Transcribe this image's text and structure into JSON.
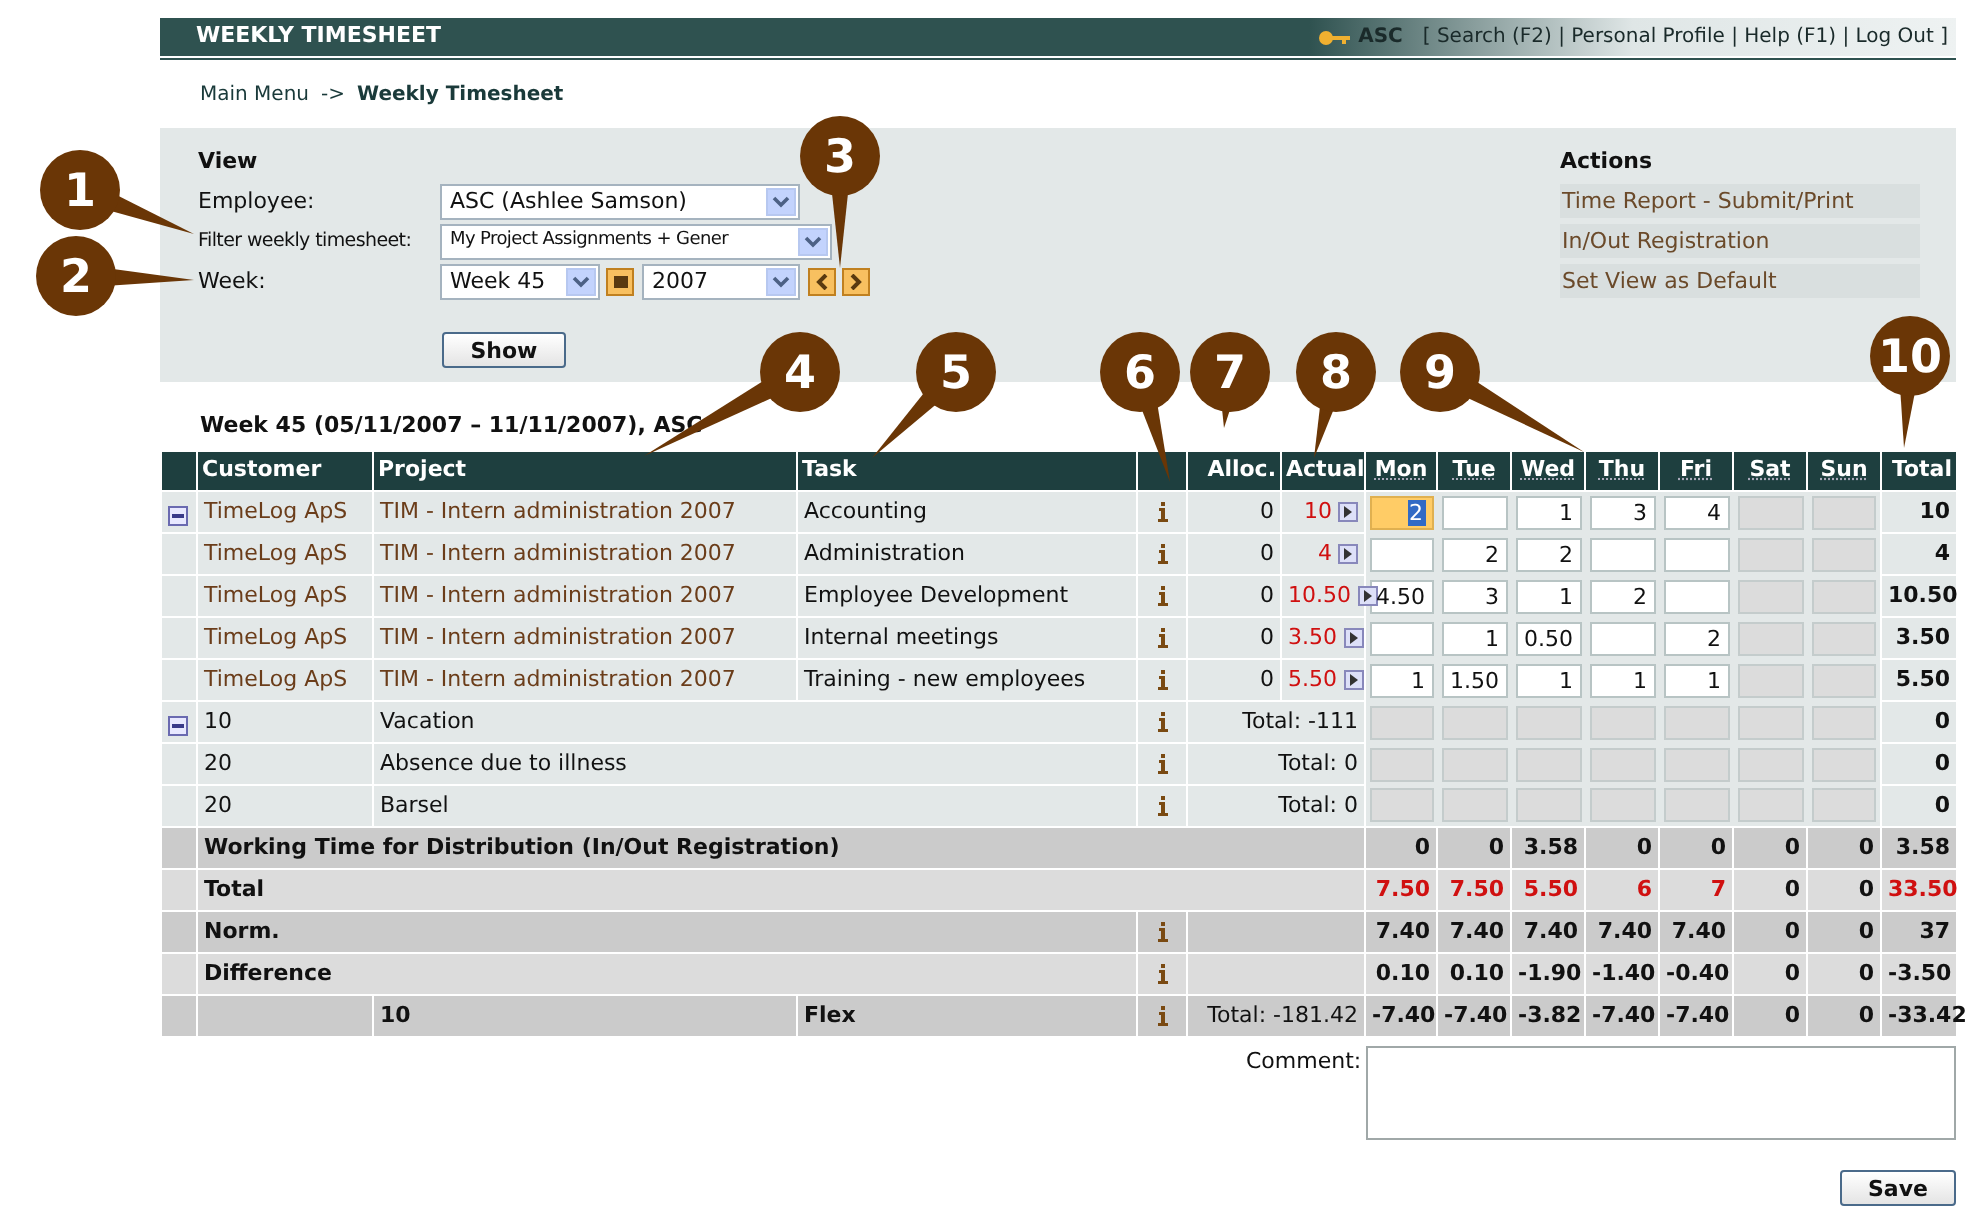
{
  "header": {
    "title": "WEEKLY TIMESHEET",
    "user": "ASC",
    "links_text": "[ Search (F2) | Personal Profile | Help (F1) | Log Out ]"
  },
  "breadcrumb": {
    "parent": "Main Menu",
    "arrow": "->",
    "current": "Weekly Timesheet"
  },
  "view": {
    "title": "View",
    "employee_label": "Employee:",
    "employee": "ASC (Ashlee Samson)",
    "filter_label": "Filter weekly timesheet:",
    "filter": "My Project Assignments + Gener",
    "week_label": "Week:",
    "week": "Week 45",
    "year": "2007",
    "show_button": "Show"
  },
  "actions": {
    "title": "Actions",
    "items": [
      "Time Report - Submit/Print",
      "In/Out Registration",
      "Set View as Default"
    ]
  },
  "week_title": "Week 45 (05/11/2007 – 11/11/2007), ASC",
  "table": {
    "columns": {
      "customer": "Customer",
      "project": "Project",
      "task": "Task",
      "alloc": "Alloc.",
      "actual": "Actual",
      "days": [
        "Mon",
        "Tue",
        "Wed",
        "Thu",
        "Fri",
        "Sat",
        "Sun"
      ],
      "total": "Total"
    },
    "rows": [
      {
        "kind": "task",
        "has_toggle": true,
        "customer": "TimeLog ApS",
        "project": "TIM - Intern administration 2007",
        "task": "Accounting",
        "alloc": "0",
        "actual": "10",
        "total": "10",
        "days": [
          {
            "value": "2",
            "selected": true,
            "disabled": false
          },
          {
            "selected": false,
            "disabled": false
          },
          {
            "value": "1",
            "selected": false,
            "disabled": false
          },
          {
            "value": "3",
            "selected": false,
            "disabled": false
          },
          {
            "value": "4",
            "selected": false,
            "disabled": false
          },
          {
            "selected": false,
            "disabled": true
          },
          {
            "selected": false,
            "disabled": true
          }
        ]
      },
      {
        "kind": "task",
        "has_toggle": false,
        "customer": "TimeLog ApS",
        "project": "TIM - Intern administration 2007",
        "task": "Administration",
        "alloc": "0",
        "actual": "4",
        "total": "4",
        "days": [
          {
            "selected": false,
            "disabled": false
          },
          {
            "value": "2",
            "selected": false,
            "disabled": false
          },
          {
            "value": "2",
            "selected": false,
            "disabled": false
          },
          {
            "selected": false,
            "disabled": false
          },
          {
            "selected": false,
            "disabled": false
          },
          {
            "selected": false,
            "disabled": true
          },
          {
            "selected": false,
            "disabled": true
          }
        ]
      },
      {
        "kind": "task",
        "has_toggle": false,
        "customer": "TimeLog ApS",
        "project": "TIM - Intern administration 2007",
        "task": "Employee Development",
        "alloc": "0",
        "actual": "10.50",
        "total": "10.50",
        "days": [
          {
            "value": "4.50",
            "selected": false,
            "disabled": false
          },
          {
            "value": "3",
            "selected": false,
            "disabled": false
          },
          {
            "value": "1",
            "selected": false,
            "disabled": false
          },
          {
            "value": "2",
            "selected": false,
            "disabled": false
          },
          {
            "selected": false,
            "disabled": false
          },
          {
            "selected": false,
            "disabled": true
          },
          {
            "selected": false,
            "disabled": true
          }
        ]
      },
      {
        "kind": "task",
        "has_toggle": false,
        "customer": "TimeLog ApS",
        "project": "TIM - Intern administration 2007",
        "task": "Internal meetings",
        "alloc": "0",
        "actual": "3.50",
        "total": "3.50",
        "days": [
          {
            "selected": false,
            "disabled": false
          },
          {
            "value": "1",
            "selected": false,
            "disabled": false
          },
          {
            "value": "0.50",
            "selected": false,
            "disabled": false
          },
          {
            "selected": false,
            "disabled": false
          },
          {
            "value": "2",
            "selected": false,
            "disabled": false
          },
          {
            "selected": false,
            "disabled": true
          },
          {
            "selected": false,
            "disabled": true
          }
        ]
      },
      {
        "kind": "task",
        "has_toggle": false,
        "customer": "TimeLog ApS",
        "project": "TIM - Intern administration 2007",
        "task": "Training - new employees",
        "alloc": "0",
        "actual": "5.50",
        "total": "5.50",
        "days": [
          {
            "value": "1",
            "selected": false,
            "disabled": false
          },
          {
            "value": "1.50",
            "selected": false,
            "disabled": false
          },
          {
            "value": "1",
            "selected": false,
            "disabled": false
          },
          {
            "value": "1",
            "selected": false,
            "disabled": false
          },
          {
            "value": "1",
            "selected": false,
            "disabled": false
          },
          {
            "selected": false,
            "disabled": true
          },
          {
            "selected": false,
            "disabled": true
          }
        ]
      },
      {
        "kind": "absence",
        "has_toggle": true,
        "code": "10",
        "name": "Vacation",
        "note": "Total: -111",
        "total": "0",
        "days": [
          {
            "selected": false,
            "disabled": true
          },
          {
            "selected": false,
            "disabled": true
          },
          {
            "selected": false,
            "disabled": true
          },
          {
            "selected": false,
            "disabled": true
          },
          {
            "selected": false,
            "disabled": true
          },
          {
            "selected": false,
            "disabled": true
          },
          {
            "selected": false,
            "disabled": true
          }
        ]
      },
      {
        "kind": "absence",
        "has_toggle": false,
        "code": "20",
        "name": "Absence due to illness",
        "note": "Total: 0",
        "total": "0",
        "days": [
          {
            "selected": false,
            "disabled": true
          },
          {
            "selected": false,
            "disabled": true
          },
          {
            "selected": false,
            "disabled": true
          },
          {
            "selected": false,
            "disabled": true
          },
          {
            "selected": false,
            "disabled": true
          },
          {
            "selected": false,
            "disabled": true
          },
          {
            "selected": false,
            "disabled": true
          }
        ]
      },
      {
        "kind": "absence",
        "has_toggle": false,
        "code": "20",
        "name": "Barsel",
        "note": "Total: 0",
        "total": "0",
        "days": [
          {
            "selected": false,
            "disabled": true
          },
          {
            "selected": false,
            "disabled": true
          },
          {
            "selected": false,
            "disabled": true
          },
          {
            "selected": false,
            "disabled": true
          },
          {
            "selected": false,
            "disabled": true
          },
          {
            "selected": false,
            "disabled": true
          },
          {
            "selected": false,
            "disabled": true
          }
        ]
      }
    ],
    "summary": [
      {
        "kind": "plain",
        "label": "Working Time for Distribution (In/Out Registration)",
        "values": [
          {
            "text": "0",
            "warning": false
          },
          {
            "text": "0",
            "warning": false
          },
          {
            "text": "3.58",
            "warning": false
          },
          {
            "text": "0",
            "warning": false
          },
          {
            "text": "0",
            "warning": false
          },
          {
            "text": "0",
            "warning": false
          },
          {
            "text": "0",
            "warning": false
          },
          {
            "text": "3.58",
            "warning": false
          }
        ]
      },
      {
        "kind": "plain",
        "label": "Total",
        "values": [
          {
            "text": "7.50",
            "warning": true
          },
          {
            "text": "7.50",
            "warning": true
          },
          {
            "text": "5.50",
            "warning": true
          },
          {
            "text": "6",
            "warning": true
          },
          {
            "text": "7",
            "warning": true
          },
          {
            "text": "0",
            "warning": false
          },
          {
            "text": "0",
            "warning": false
          },
          {
            "text": "33.50",
            "warning": true
          }
        ]
      },
      {
        "kind": "info",
        "label": "Norm.",
        "values": [
          {
            "text": "7.40",
            "warning": false
          },
          {
            "text": "7.40",
            "warning": false
          },
          {
            "text": "7.40",
            "warning": false
          },
          {
            "text": "7.40",
            "warning": false
          },
          {
            "text": "7.40",
            "warning": false
          },
          {
            "text": "0",
            "warning": false
          },
          {
            "text": "0",
            "warning": false
          },
          {
            "text": "37",
            "warning": false
          }
        ]
      },
      {
        "kind": "info",
        "label": "Difference",
        "values": [
          {
            "text": "0.10",
            "warning": false
          },
          {
            "text": "0.10",
            "warning": false
          },
          {
            "text": "-1.90",
            "warning": false
          },
          {
            "text": "-1.40",
            "warning": false
          },
          {
            "text": "-0.40",
            "warning": false
          },
          {
            "text": "0",
            "warning": false
          },
          {
            "text": "0",
            "warning": false
          },
          {
            "text": "-3.50",
            "warning": false
          }
        ]
      },
      {
        "kind": "flex",
        "code": "10",
        "name": "Flex",
        "note": "Total: -181.42",
        "values": [
          {
            "text": "-7.40",
            "warning": false
          },
          {
            "text": "-7.40",
            "warning": false
          },
          {
            "text": "-3.82",
            "warning": false
          },
          {
            "text": "-7.40",
            "warning": false
          },
          {
            "text": "-7.40",
            "warning": false
          },
          {
            "text": "0",
            "warning": false
          },
          {
            "text": "0",
            "warning": false
          },
          {
            "text": "-33.42",
            "warning": false
          }
        ]
      }
    ]
  },
  "comment_label": "Comment:",
  "save_button": "Save",
  "callouts": [
    "1",
    "2",
    "3",
    "4",
    "5",
    "6",
    "7",
    "8",
    "9",
    "10"
  ]
}
